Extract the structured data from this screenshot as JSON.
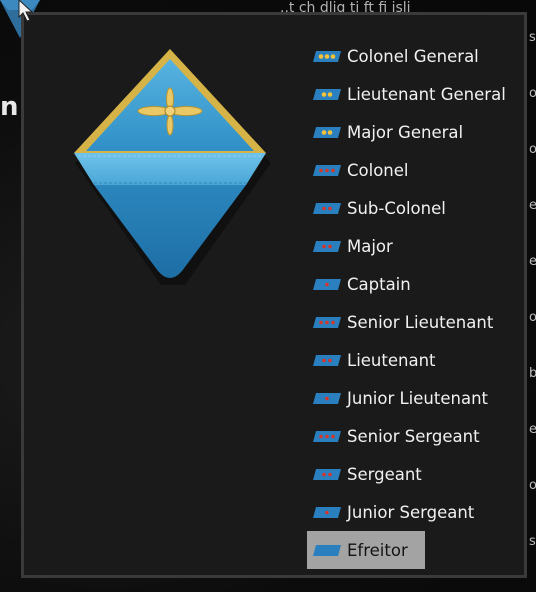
{
  "background": {
    "top_text": "..t ch dlig  ti   ft   fi isli",
    "left_letter": "n",
    "right_fragments": [
      "s",
      "o",
      "o",
      "e",
      "e",
      "o",
      "b",
      "e",
      "o",
      "s"
    ]
  },
  "colors": {
    "panel_bg": "#1a1a1a",
    "panel_border": "#3a3a3a",
    "selected_bg": "#a3a3a3",
    "badge_blue": "#2a7fbf",
    "star_gold": "#f2c33a",
    "star_red": "#d8342a"
  },
  "insignia": {
    "icon": "air-force-shoulder-patch-icon"
  },
  "ranks": [
    {
      "label": "Colonel General",
      "mark": "gold-stars",
      "count": 3
    },
    {
      "label": "Lieutenant General",
      "mark": "gold-stars",
      "count": 2
    },
    {
      "label": "Major General",
      "mark": "gold-stars",
      "count": 2
    },
    {
      "label": "Colonel",
      "mark": "red-stars",
      "count": 3
    },
    {
      "label": "Sub-Colonel",
      "mark": "red-stars",
      "count": 2
    },
    {
      "label": "Major",
      "mark": "red-stars",
      "count": 2
    },
    {
      "label": "Captain",
      "mark": "red-stars",
      "count": 1
    },
    {
      "label": "Senior Lieutenant",
      "mark": "red-stars",
      "count": 3
    },
    {
      "label": "Lieutenant",
      "mark": "red-stars",
      "count": 2
    },
    {
      "label": "Junior Lieutenant",
      "mark": "red-stars",
      "count": 1
    },
    {
      "label": "Senior Sergeant",
      "mark": "red-stars",
      "count": 3
    },
    {
      "label": "Sergeant",
      "mark": "red-stars",
      "count": 2
    },
    {
      "label": "Junior Sergeant",
      "mark": "red-stars",
      "count": 1
    },
    {
      "label": "Efreitor",
      "mark": "plain",
      "count": 0,
      "selected": true
    }
  ]
}
